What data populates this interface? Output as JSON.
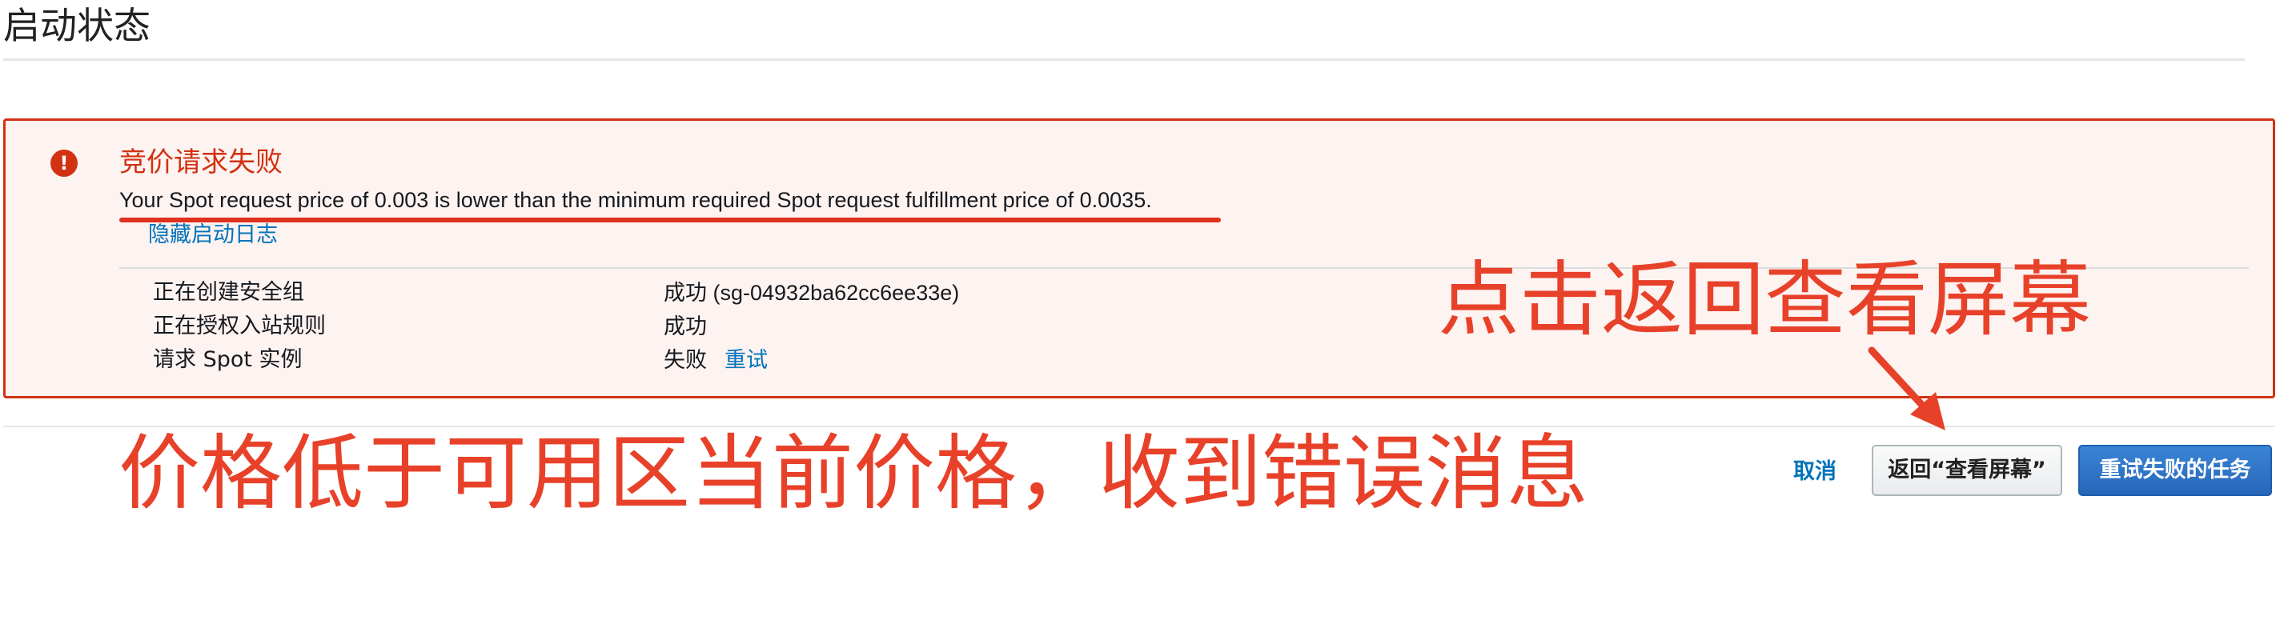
{
  "page": {
    "title": "启动状态"
  },
  "alert": {
    "icon": "exclamation-icon",
    "icon_glyph": "!",
    "title": "竞价请求失败",
    "message": "Your Spot request price of 0.003 is lower than the minimum required Spot request fulfillment price of 0.0035.",
    "hide_log_link": "隐藏启动日志",
    "log": [
      {
        "step": "正在创建安全组",
        "status": "成功 (sg-04932ba62cc6ee33e)"
      },
      {
        "step": "正在授权入站规则",
        "status": "成功"
      },
      {
        "step": "请求 Spot 实例",
        "status": "失败",
        "action": "重试"
      }
    ]
  },
  "annotations": {
    "right": "点击返回查看屏幕",
    "left": "价格低于可用区当前价格，收到错误消息"
  },
  "footer": {
    "cancel_label": "取消",
    "back_label": "返回“查看屏幕”",
    "retry_failed_label": "重试失败的任务"
  },
  "colors": {
    "error": "#d13212",
    "annotation": "#e8412a",
    "link": "#0073bb",
    "primary_button": "#2767b8"
  }
}
